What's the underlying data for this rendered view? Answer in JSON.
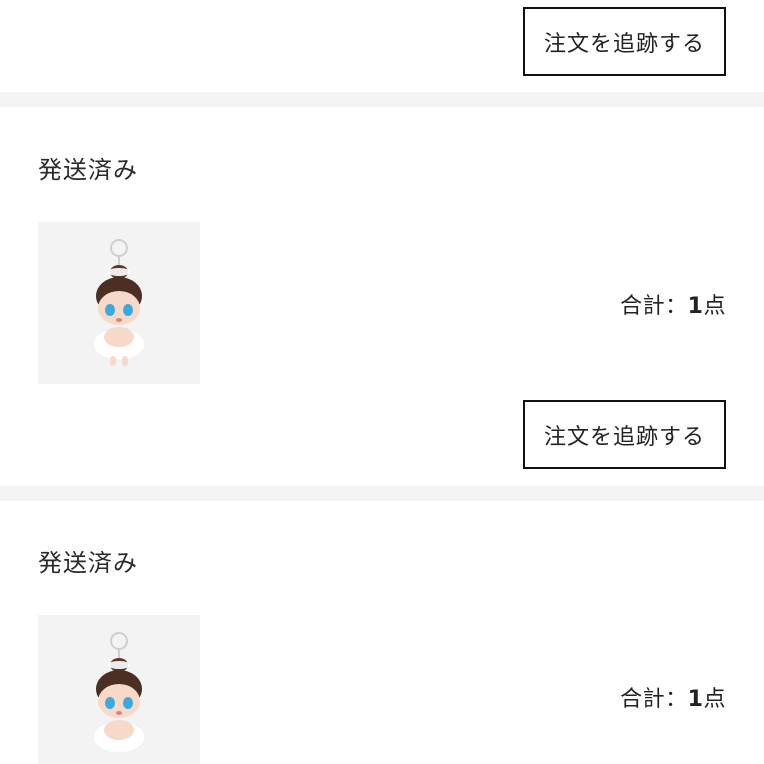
{
  "orders": [
    {
      "track_label": "注文を追跡する"
    },
    {
      "status": "発送済み",
      "total_label": "合計：",
      "total_count": "1",
      "total_unit": "点",
      "track_label": "注文を追跡する",
      "product_icon": "doll-keychain-icon"
    },
    {
      "status": "発送済み",
      "total_label": "合計：",
      "total_count": "1",
      "total_unit": "点",
      "product_icon": "doll-keychain-icon"
    }
  ],
  "colors": {
    "divider": "#f4f4f4",
    "button_border": "#111111",
    "thumb_bg": "#f3f3f3",
    "doll_eye": "#3aa9e0"
  }
}
